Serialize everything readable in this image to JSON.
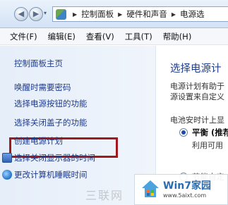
{
  "address_bar": {
    "breadcrumbs": [
      "控制面板",
      "硬件和声音",
      "电源选"
    ],
    "back_icon": "back-arrow-icon",
    "forward_icon": "forward-arrow-icon"
  },
  "menu": {
    "items": [
      "文件(F)",
      "编辑(E)",
      "查看(V)",
      "工具(T)",
      "帮助(H)"
    ]
  },
  "sidebar": {
    "home": "控制面板主页",
    "items": [
      {
        "label": "唤醒时需要密码",
        "icon": null
      },
      {
        "label": "选择电源按钮的功能",
        "icon": null,
        "highlighted": true
      },
      {
        "label": "选择关闭盖子的功能",
        "icon": null
      },
      {
        "label": "创建电源计划",
        "icon": null
      },
      {
        "label": "选择关闭显示器的时间",
        "icon": "display-icon"
      },
      {
        "label": "更改计算机睡眠时间",
        "icon": "sleep-icon"
      }
    ],
    "highlight_color": "#a0191f"
  },
  "main": {
    "title": "选择电源计",
    "desc_line1": "电源计划有助于",
    "desc_line2": "源设置来自定义",
    "battery_label": "电池安时计上显",
    "plan1_name": "平衡 (推荐",
    "plan1_desc": "利用可用",
    "plan2_name": "节能自定"
  },
  "watermark": {
    "left_text": "三联网",
    "site_title": "Win7家园",
    "site_url": "www.5aixt.com"
  }
}
